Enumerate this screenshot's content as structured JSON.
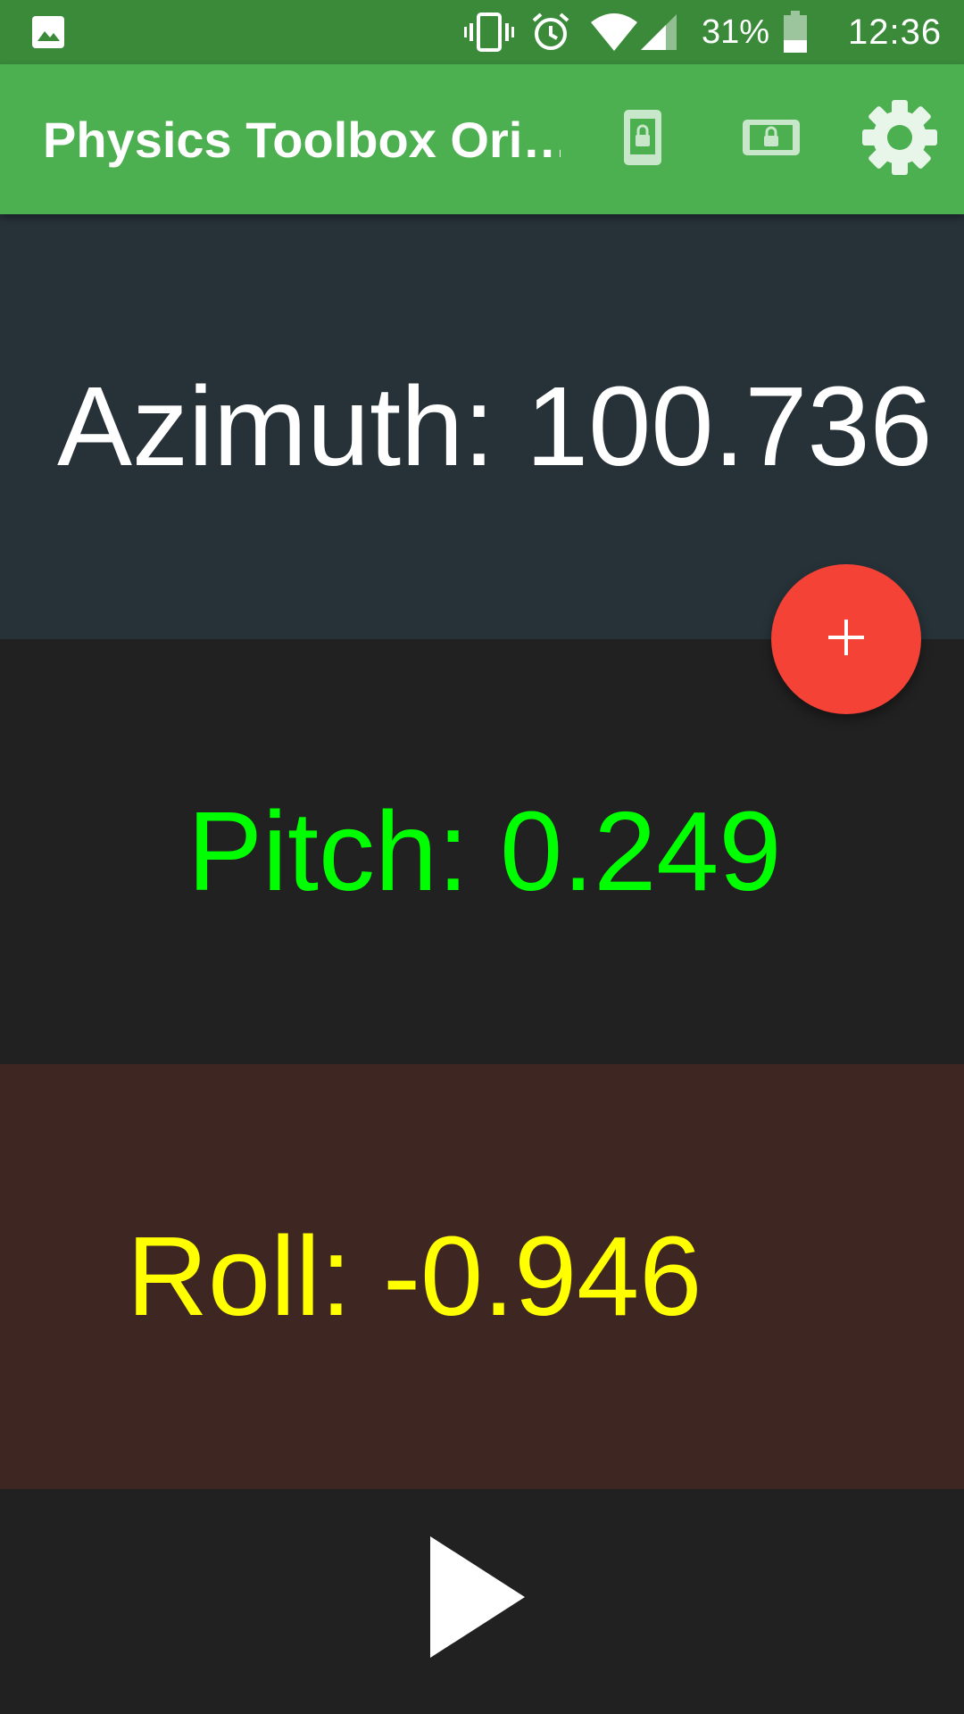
{
  "status_bar": {
    "battery_percent": "31%",
    "time": "12:36",
    "icons": [
      "gallery-icon",
      "vibrate-icon",
      "alarm-icon",
      "wifi-icon",
      "cell-signal-icon",
      "battery-icon"
    ]
  },
  "app_bar": {
    "title": "Physics Toolbox Ori…",
    "actions": [
      "portrait-lock-icon",
      "landscape-lock-icon",
      "settings-gear-icon"
    ]
  },
  "readings": {
    "azimuth": "Azimuth: 100.736",
    "pitch": "Pitch: 0.249",
    "roll": "Roll: -0.946"
  },
  "fab": {
    "icon": "plus-icon",
    "glyph": "+"
  },
  "controls": {
    "play_icon": "play-icon"
  },
  "colors": {
    "status_bar": "#3a8a3a",
    "app_bar": "#4caf50",
    "azimuth_panel": "#263238",
    "pitch_panel": "#212121",
    "roll_panel": "#3e2723",
    "azimuth_text": "#ffffff",
    "pitch_text": "#00ff00",
    "roll_text": "#ffff00",
    "fab": "#f44336"
  }
}
